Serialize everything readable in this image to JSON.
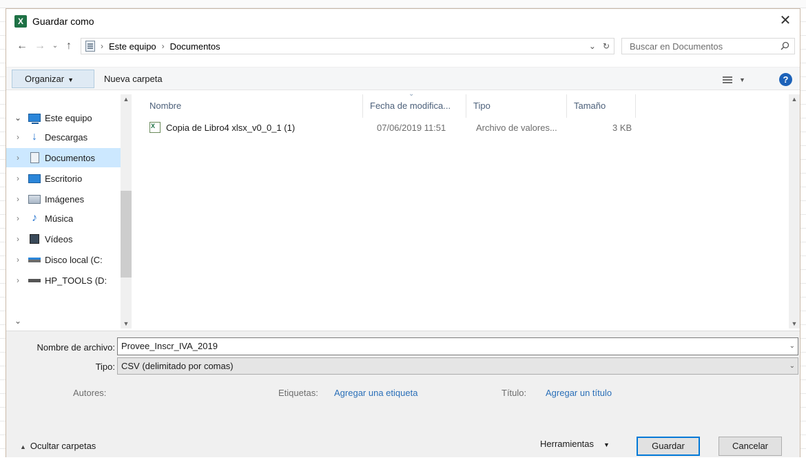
{
  "dialog": {
    "title": "Guardar como",
    "app_icon": "X",
    "close_glyph": "✕"
  },
  "navigation": {
    "back_glyph": "←",
    "forward_glyph": "→",
    "recent_glyph": "⌄",
    "up_glyph": "↑",
    "breadcrumb": [
      "Este equipo",
      "Documentos"
    ],
    "crumb_separator": "›",
    "dropdown_glyph": "⌄",
    "refresh_glyph": "↻"
  },
  "search": {
    "placeholder": "Buscar en Documentos"
  },
  "toolbar": {
    "organize_label": "Organizar",
    "new_folder_label": "Nueva carpeta",
    "help_label": "?"
  },
  "sidebar": {
    "items": [
      {
        "label": "Este equipo",
        "icon": "computer-icon",
        "expanded": true
      },
      {
        "label": "Descargas",
        "icon": "downloads-icon"
      },
      {
        "label": "Documentos",
        "icon": "documents-icon",
        "selected": true
      },
      {
        "label": "Escritorio",
        "icon": "desktop-icon"
      },
      {
        "label": "Imágenes",
        "icon": "pictures-icon"
      },
      {
        "label": "Música",
        "icon": "music-icon"
      },
      {
        "label": "Vídeos",
        "icon": "videos-icon"
      },
      {
        "label": "Disco local (C:",
        "icon": "local-disk-icon"
      },
      {
        "label": "HP_TOOLS (D:",
        "icon": "drive-icon"
      }
    ]
  },
  "file_list": {
    "columns": [
      "Nombre",
      "Fecha de modifica...",
      "Tipo",
      "Tamaño"
    ],
    "rows": [
      {
        "name": "Copia de Libro4 xlsx_v0_0_1 (1)",
        "date": "07/06/2019 11:51",
        "type": "Archivo de valores...",
        "size": "3 KB"
      }
    ]
  },
  "form": {
    "filename_label": "Nombre de archivo:",
    "filename_value": "Provee_Inscr_IVA_2019",
    "type_label": "Tipo:",
    "type_value": "CSV (delimitado por comas)",
    "authors_label": "Autores:",
    "tags_label": "Etiquetas:",
    "tags_link": "Agregar una etiqueta",
    "title_label": "Título:",
    "title_link": "Agregar un título"
  },
  "footer": {
    "hide_folders_label": "Ocultar carpetas",
    "tools_label": "Herramientas",
    "save_label": "Guardar",
    "cancel_label": "Cancelar"
  },
  "colors": {
    "accent": "#0078d7",
    "selection": "#cce8ff",
    "link": "#2a6fb8",
    "excel_green": "#1e7145"
  }
}
